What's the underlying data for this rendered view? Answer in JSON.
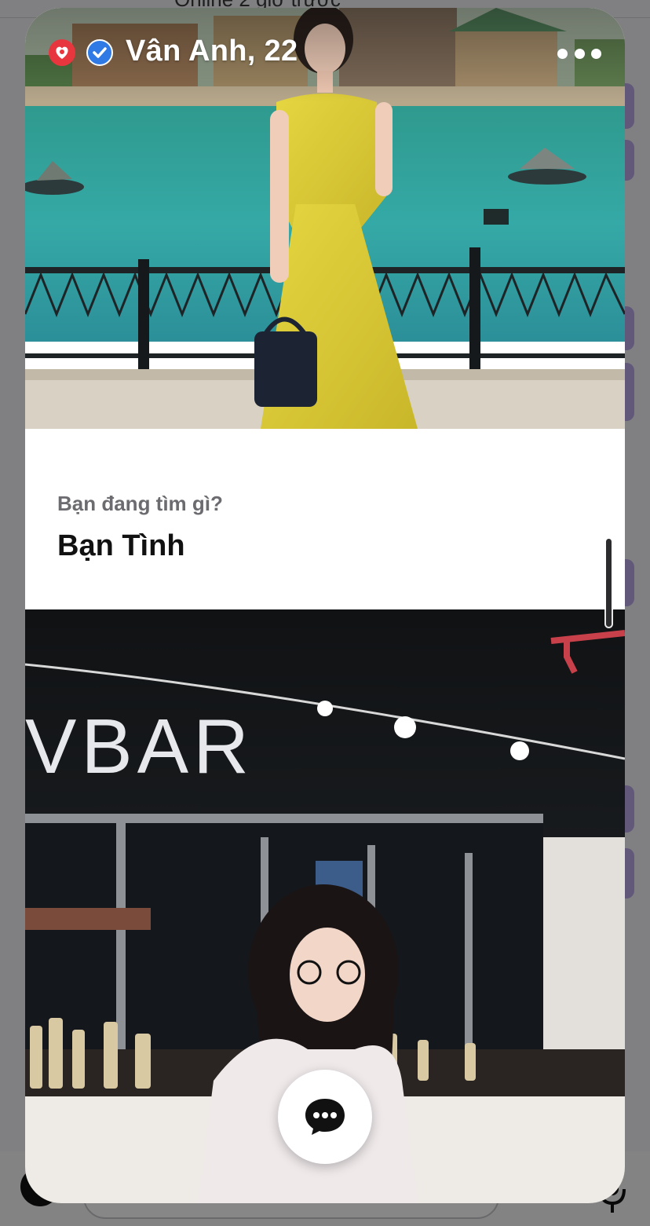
{
  "background": {
    "status_text": "Online 2 giờ trước"
  },
  "profile": {
    "name_age": "Vân Anh, 22",
    "brand_icon": "brand-heart-icon",
    "verified_icon": "verified-check-icon",
    "more_icon": "more-dots-icon"
  },
  "prompt": {
    "question": "Bạn đang tìm gì?",
    "answer": "Bạn Tình"
  },
  "photo_2": {
    "sign_text": "VBAR"
  },
  "actions": {
    "chat_icon": "chat-bubble-icon"
  },
  "colors": {
    "brand_red": "#e8363e",
    "verified_blue": "#2f7ae5",
    "accent_purple": "#b9a7e6"
  }
}
